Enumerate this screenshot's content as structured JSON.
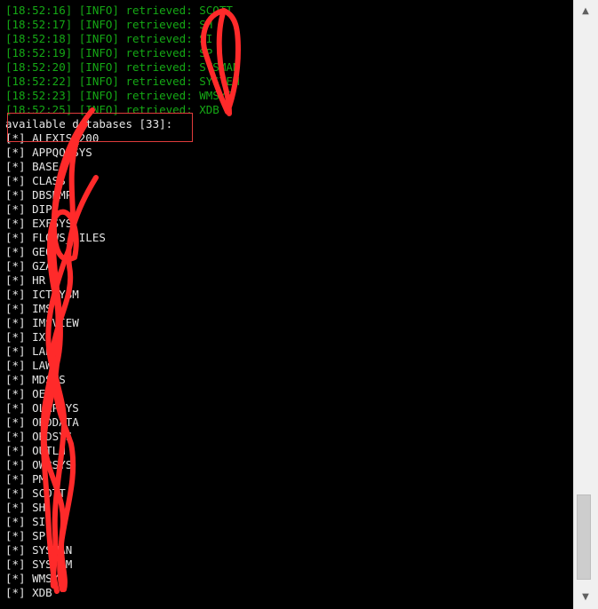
{
  "log_lines": [
    "[18:52:16] [INFO] retrieved: SCOTT",
    "[18:52:17] [INFO] retrieved: SH",
    "[18:52:18] [INFO] retrieved: SI",
    "[18:52:19] [INFO] retrieved: SP",
    "[18:52:20] [INFO] retrieved: SYSMAN",
    "[18:52:22] [INFO] retrieved: SYSTEM",
    "[18:52:23] [INFO] retrieved: WMSYS",
    "[18:52:25] [INFO] retrieved: XDB"
  ],
  "databases_header": "available databases [33]:",
  "databases": [
    "[*] ALEXIS_200",
    "[*] APPQOSSYS",
    "[*] BASE",
    "[*] CLASS",
    "[*] DBSNMP",
    "[*] DIP",
    "[*] EXFSYS",
    "[*] FLOWS_FILES",
    "[*] GEO",
    "[*] GZA",
    "[*] HR",
    "[*] ICTSYSM",
    "[*] IMS",
    "[*] IMSVIEW",
    "[*] IX",
    "[*] LAB",
    "[*] LAW",
    "[*] MDSYS",
    "[*] OE",
    "[*] OLAPSYS",
    "[*] ORDDATA",
    "[*] ORDSYS",
    "[*] OUTLN",
    "[*] OWBSYS",
    "[*] PM",
    "[*] SCOTT",
    "[*] SH",
    "[*] SI",
    "[*] SP",
    "[*] SYSMAN",
    "[*] SYSTEM",
    "[*] WMSYS",
    "[*] XDB"
  ],
  "scrollbar": {
    "up_arrow": "▲",
    "down_arrow": "▼"
  },
  "colors": {
    "background": "#000000",
    "log_text": "#15a815",
    "db_text": "#e6e6e6",
    "annotation_red": "#ff2a2a"
  }
}
